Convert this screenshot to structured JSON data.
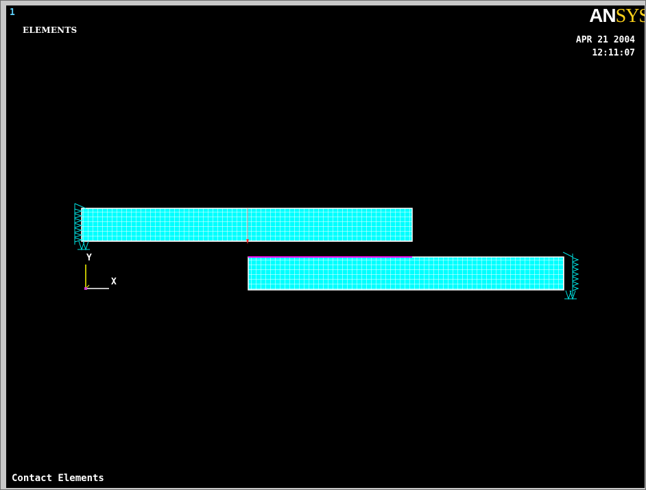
{
  "window": {
    "number": "1",
    "plot_label": "ELEMENTS",
    "logo_part1": "AN",
    "logo_part2": "SYS",
    "date": "APR 21 2004",
    "time": "12:11:07",
    "footer_title": "Contact Elements"
  },
  "triad": {
    "x_label": "X",
    "y_label": "Y"
  },
  "colors": {
    "background": "#000000",
    "mesh_fill": "#00ffff",
    "mesh_lines": "#ffffff",
    "constraint": "#00e5e5",
    "contact_line": "#ff00ff",
    "force_marker": "#ff3030",
    "axis_x": "#ffffff",
    "axis_y": "#ffff00",
    "logo_accent": "#ffd21a"
  },
  "icons": {
    "constraint": "triangle-constraint-icon",
    "triad": "coordinate-triad-icon"
  }
}
